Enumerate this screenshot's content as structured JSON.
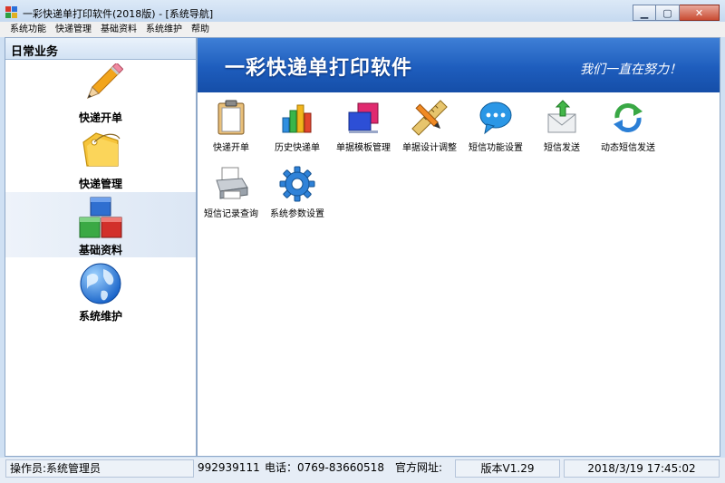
{
  "window": {
    "title": "一彩快递单打印软件(2018版) - [系统导航]",
    "controls": {
      "minimize": "▁",
      "maximize": "▢",
      "close": "✕"
    }
  },
  "menu": [
    "系统功能",
    "快递管理",
    "基础资料",
    "系统维护",
    "帮助"
  ],
  "sidebar": {
    "header": "日常业务",
    "items": [
      {
        "label": "快递开单",
        "icon": "pencil-icon"
      },
      {
        "label": "快递管理",
        "icon": "tag-icon"
      },
      {
        "label": "基础资料",
        "icon": "blocks-icon"
      },
      {
        "label": "系统维护",
        "icon": "globe-icon"
      }
    ],
    "active": 2
  },
  "banner": {
    "title": "一彩快递单打印软件",
    "slogan": "我们一直在努力！"
  },
  "tiles": [
    {
      "label": "快递开单",
      "icon": "clipboard-icon"
    },
    {
      "label": "历史快递单",
      "icon": "bar-chart-icon"
    },
    {
      "label": "单据模板管理",
      "icon": "template-icon"
    },
    {
      "label": "单据设计调整",
      "icon": "ruler-pencil-icon"
    },
    {
      "label": "短信功能设置",
      "icon": "chat-bubble-icon"
    },
    {
      "label": "短信发送",
      "icon": "envelope-icon"
    },
    {
      "label": "动态短信发送",
      "icon": "refresh-icon"
    },
    {
      "label": "短信记录查询",
      "icon": "printer-icon"
    },
    {
      "label": "系统参数设置",
      "icon": "gear-icon"
    }
  ],
  "status": {
    "operator": "操作员:系统管理员",
    "qq": "992939111",
    "phone": "电话：0769-83660518",
    "website": "官方网址:",
    "version": "版本V1.29",
    "datetime": "2018/3/19 17:45:02"
  },
  "colors": {
    "banner": "#1e5dbd",
    "accent": "#3e7fd6"
  }
}
